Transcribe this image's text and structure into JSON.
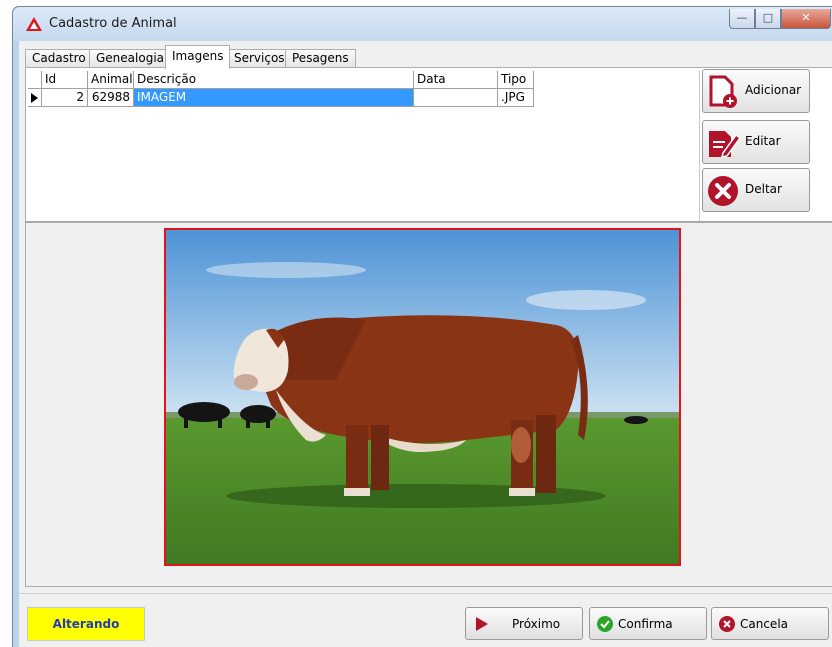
{
  "window": {
    "title": "Cadastro de Animal"
  },
  "tabs": [
    {
      "label": "Cadastro"
    },
    {
      "label": "Genealogia"
    },
    {
      "label": "Imagens"
    },
    {
      "label": "Serviços"
    },
    {
      "label": "Pesagens"
    }
  ],
  "active_tab": "Imagens",
  "grid": {
    "columns": [
      "Id",
      "Animal",
      "Descrição",
      "Data",
      "Tipo"
    ],
    "rows": [
      {
        "id": "2",
        "animal": "62988",
        "descricao": "IMAGEM",
        "data": "",
        "tipo": ".JPG"
      }
    ]
  },
  "side_buttons": {
    "add": "Adicionar",
    "edit": "Editar",
    "delete": "Deltar"
  },
  "status": {
    "text": "Alterando",
    "color": "#ffff00"
  },
  "footer": {
    "next": "Próximo",
    "confirm": "Confirma",
    "cancel": "Cancela"
  },
  "colors": {
    "accent": "#3399ff",
    "frame": "#e0151b"
  }
}
